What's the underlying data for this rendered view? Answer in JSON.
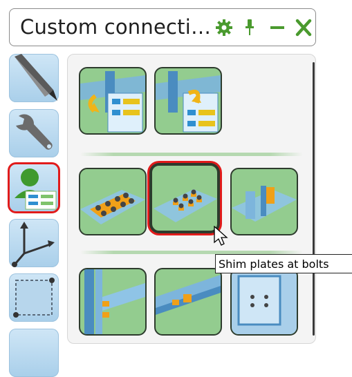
{
  "window": {
    "title": "Custom connecti…",
    "icons": [
      "gear-icon",
      "pin-icon",
      "minimize-icon",
      "close-icon"
    ],
    "icon_color": "#4a9a2e"
  },
  "sidebar": {
    "items": [
      {
        "name": "pencil-tool",
        "icon": "pencil-icon"
      },
      {
        "name": "wrench-tool",
        "icon": "wrench-icon"
      },
      {
        "name": "custom-component-tool",
        "icon": "user-component-icon",
        "selected": true
      },
      {
        "name": "coordinate-axes-tool",
        "icon": "axes-icon"
      },
      {
        "name": "selection-box-tool",
        "icon": "selection-box-icon"
      }
    ]
  },
  "catalog": {
    "rows": [
      [
        {
          "name": "connection-explode-left",
          "icon": "beam-explode-icon"
        },
        {
          "name": "connection-explode-right",
          "icon": "beam-explode-icon"
        }
      ],
      [
        {
          "name": "bolt-plate",
          "icon": "bolt-plate-icon"
        },
        {
          "name": "shim-plates-at-bolts",
          "icon": "shim-plates-icon",
          "selected": true
        },
        {
          "name": "end-plate",
          "icon": "end-plate-icon"
        }
      ],
      [
        {
          "name": "column-beam-connection",
          "icon": "column-beam-icon"
        },
        {
          "name": "beam-splice",
          "icon": "beam-splice-icon"
        },
        {
          "name": "stiffener-plate",
          "icon": "stiffener-icon"
        }
      ]
    ],
    "tile_color": "#93cc8f",
    "selection_color": "#e11b1b"
  },
  "tooltip": {
    "text": "Shim plates at bolts"
  }
}
